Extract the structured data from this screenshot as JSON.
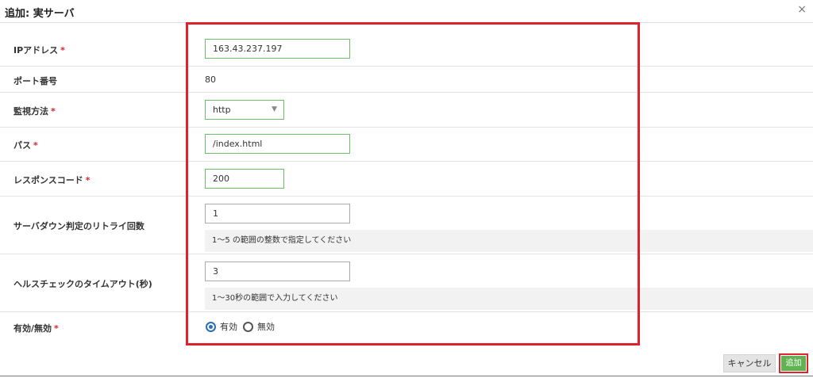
{
  "dialog": {
    "title": "追加: 実サーバ",
    "close_label": "×"
  },
  "required_mark": "*",
  "fields": {
    "ip": {
      "label": "IPアドレス",
      "value": "163.43.237.197"
    },
    "port": {
      "label": "ポート番号",
      "value": "80"
    },
    "monitor": {
      "label": "監視方法",
      "value": "http"
    },
    "path": {
      "label": "パス",
      "value": "/index.html"
    },
    "response": {
      "label": "レスポンスコード",
      "value": "200"
    },
    "retry": {
      "label": "サーバダウン判定のリトライ回数",
      "value": "1",
      "hint": "1～5 の範囲の整数で指定してください"
    },
    "timeout": {
      "label": "ヘルスチェックのタイムアウト(秒)",
      "value": "3",
      "hint": "1～30秒の範囲で入力してください"
    },
    "enabled": {
      "label": "有効/無効",
      "options": [
        "有効",
        "無効"
      ],
      "selected": "有効"
    }
  },
  "buttons": {
    "cancel": "キャンセル",
    "add": "追加"
  },
  "colors": {
    "highlight": "#e0212e",
    "valid_border": "#6abf69",
    "add_button": "#61b351",
    "radio_selected": "#2c6fb2"
  }
}
